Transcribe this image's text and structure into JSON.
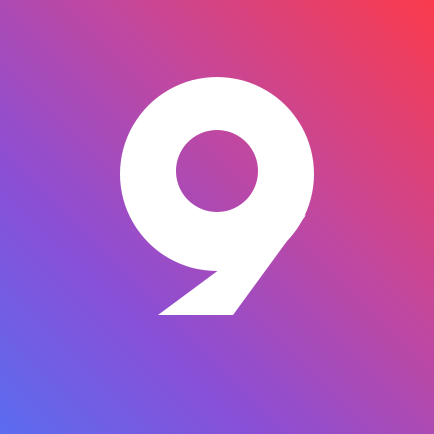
{
  "icon": {
    "numeral": "9",
    "colors": {
      "gradient_start": "#5b6cf0",
      "gradient_mid_1": "#8a4fd6",
      "gradient_mid_2": "#c2479e",
      "gradient_end": "#fb3b4c",
      "numeral_fill": "#ffffff"
    }
  }
}
